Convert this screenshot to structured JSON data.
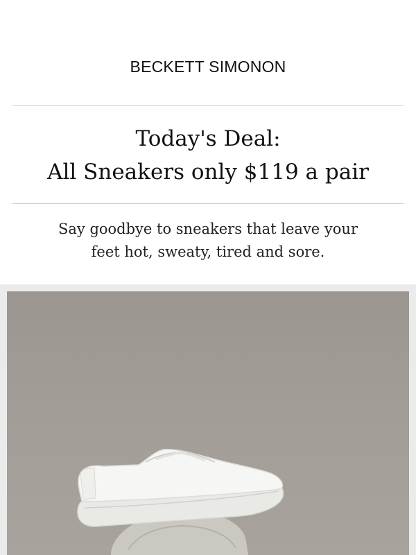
{
  "brand": {
    "logo_text": "BECKETT SIMONON"
  },
  "deal": {
    "line1": "Today's Deal:",
    "line2": "All Sneakers only $119 a pair"
  },
  "body": {
    "line1": "Say goodbye to sneakers that leave your",
    "line2": "feet hot, sweaty, tired and sore."
  },
  "hero": {
    "subject": "white-leather-sneaker-on-stone",
    "background_color": "#a09b95",
    "sneaker_color": "#f4f4f2",
    "stone_color": "#c8c6bf"
  }
}
